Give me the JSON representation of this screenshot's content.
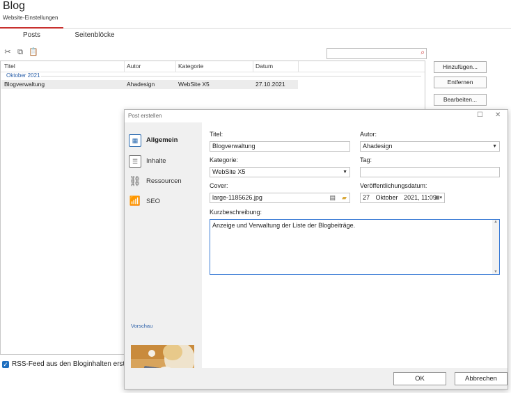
{
  "app": {
    "title": "Blog",
    "subtitle": "Website-Einstellungen"
  },
  "tabs": [
    {
      "label": "Posts",
      "active": true
    },
    {
      "label": "Seitenblöcke",
      "active": false
    }
  ],
  "toolbar": {
    "icons": [
      "cut-icon",
      "copy-icon",
      "paste-icon"
    ]
  },
  "search": {
    "value": "",
    "icon": "search-icon"
  },
  "list": {
    "columns": [
      "Titel",
      "Autor",
      "Kategorie",
      "Datum"
    ],
    "group": "Oktober 2021",
    "rows": [
      {
        "title": "Blogverwaltung",
        "author": "Ahadesign",
        "category": "WebSite X5",
        "date": "27.10.2021"
      }
    ]
  },
  "buttons": {
    "add": "Hinzufügen...",
    "remove": "Entfernen",
    "edit": "Bearbeiten..."
  },
  "rss": {
    "label": "RSS-Feed aus den Bloginhalten erstellen",
    "checked": true
  },
  "dialog": {
    "title": "Post erstellen",
    "nav": [
      {
        "label": "Allgemein",
        "icon": "layout-icon",
        "active": true
      },
      {
        "label": "Inhalte",
        "icon": "document-icon",
        "active": false
      },
      {
        "label": "Ressourcen",
        "icon": "link-icon",
        "active": false
      },
      {
        "label": "SEO",
        "icon": "bar-chart-icon",
        "active": false
      }
    ],
    "preview_label": "Vorschau",
    "fields": {
      "titel_label": "Titel:",
      "titel_value": "Blogverwaltung",
      "autor_label": "Autor:",
      "autor_value": "Ahadesign",
      "kategorie_label": "Kategorie:",
      "kategorie_value": "WebSite X5",
      "tag_label": "Tag:",
      "tag_value": "",
      "cover_label": "Cover:",
      "cover_value": "large-1185626.jpg",
      "datum_label": "Veröffentlichungsdatum:",
      "datum_day": "27",
      "datum_month": "Oktober",
      "datum_year_time": "2021, 11:09",
      "kurz_label": "Kurzbeschreibung:",
      "kurz_value": "Anzeige und Verwaltung der Liste der Blogbeiträge."
    },
    "ok": "OK",
    "cancel": "Abbrechen"
  }
}
